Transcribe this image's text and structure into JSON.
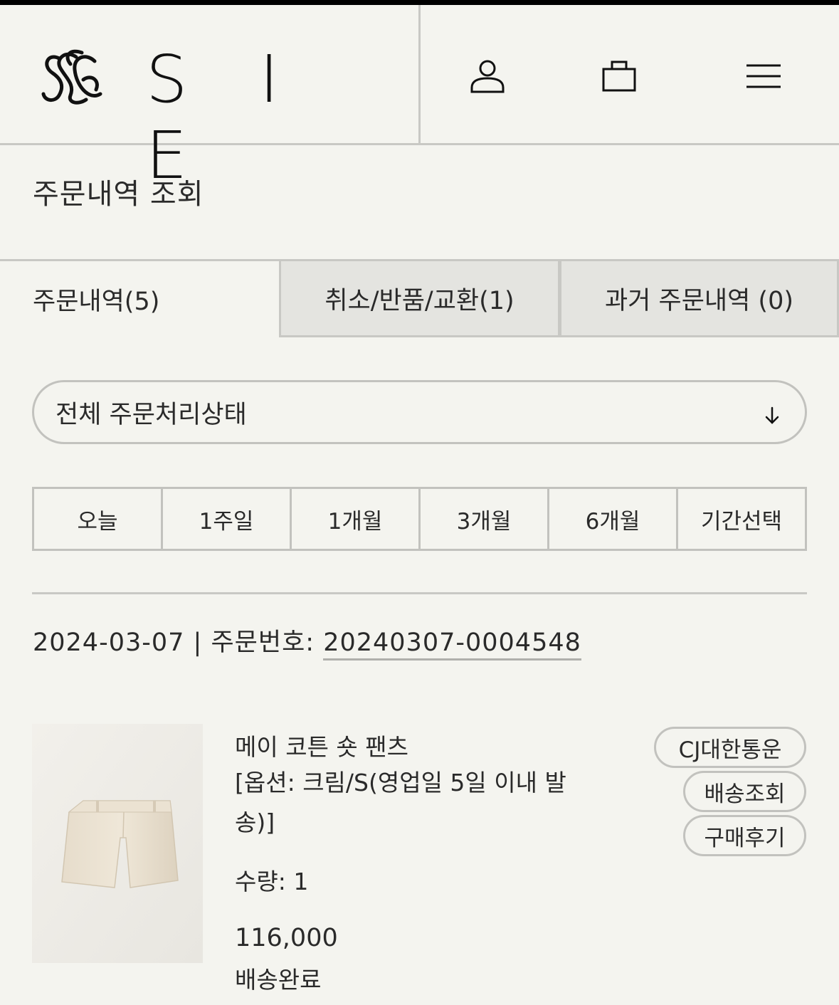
{
  "header": {
    "logo_text": "S I E",
    "icons": [
      "user-icon",
      "shopping-bag-icon",
      "menu-icon"
    ]
  },
  "page": {
    "title": "주문내역 조회"
  },
  "tabs": [
    {
      "label": "주문내역(5)",
      "active": true
    },
    {
      "label": "취소/반품/교환(1)",
      "active": false
    },
    {
      "label": "과거 주문내역 (0)",
      "active": false
    }
  ],
  "filter": {
    "status_value": "전체 주문처리상태"
  },
  "periods": [
    "오늘",
    "1주일",
    "1개월",
    "3개월",
    "6개월",
    "기간선택"
  ],
  "order": {
    "date": "2024-03-07",
    "separator": "|",
    "number_label": "주문번호:",
    "number": "20240307-0004548",
    "item": {
      "name": "메이 코튼 숏 팬츠",
      "option": "[옵션: 크림/S(영업일 5일 이내 발송)]",
      "quantity": "수량: 1",
      "price": "116,000",
      "status": "배송완료",
      "carrier": "CJ대한통운",
      "track_label": "배송조회",
      "review_label": "구매후기"
    }
  },
  "colors": {
    "background": "#f4f4ef",
    "border": "#c8c8c4",
    "inactive_tab": "#e4e4e0",
    "text": "#2a2a2a"
  }
}
